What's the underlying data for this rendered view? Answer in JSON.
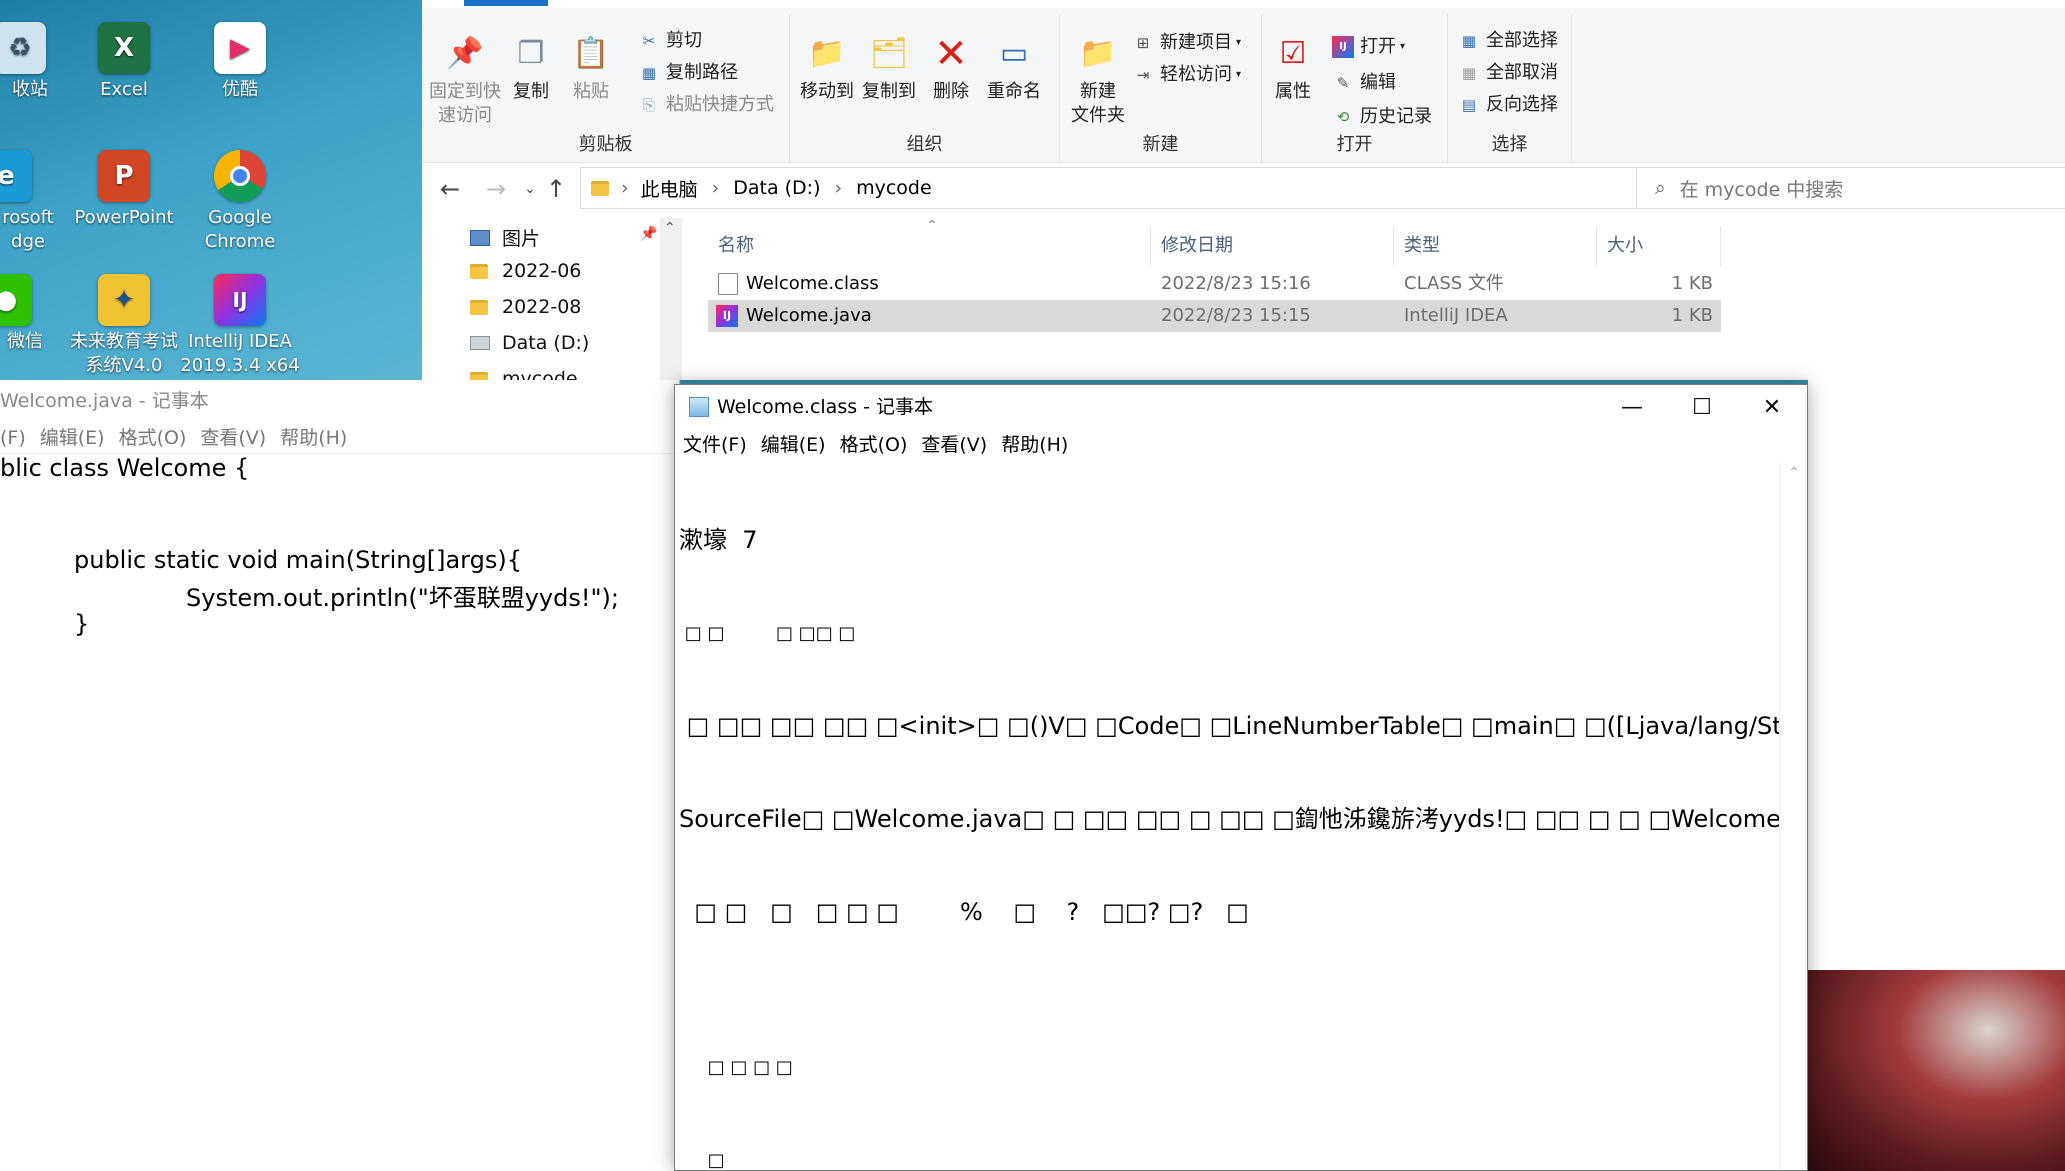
{
  "desktop": {
    "icons": [
      {
        "label": "收站"
      },
      {
        "label": "Excel"
      },
      {
        "label": "优酷"
      },
      {
        "label": "rosoft"
      },
      {
        "label": "dge"
      },
      {
        "label": "PowerPoint"
      },
      {
        "label": "Google"
      },
      {
        "label": "Chrome"
      },
      {
        "label": "微信"
      },
      {
        "label": "未来教育考试"
      },
      {
        "label": "系统V4.0"
      },
      {
        "label": "IntelliJ IDEA"
      },
      {
        "label": "2019.3.4 x64"
      }
    ]
  },
  "explorer": {
    "ribbon": {
      "clipboard": {
        "pin_line1": "固定到快",
        "pin_line2": "速访问",
        "copy": "复制",
        "paste": "粘贴",
        "cut": "剪切",
        "copy_path": "复制路径",
        "paste_shortcut": "粘贴快捷方式",
        "label": "剪贴板"
      },
      "organize": {
        "move_to": "移动到",
        "copy_to": "复制到",
        "delete": "删除",
        "rename": "重命名",
        "label": "组织"
      },
      "new": {
        "new_folder_line1": "新建",
        "new_folder_line2": "文件夹",
        "new_item": "新建项目",
        "easy_access": "轻松访问",
        "label": "新建"
      },
      "open": {
        "properties": "属性",
        "open": "打开",
        "edit": "编辑",
        "history": "历史记录",
        "label": "打开"
      },
      "select": {
        "select_all": "全部选择",
        "select_none": "全部取消",
        "invert": "反向选择",
        "label": "选择"
      }
    },
    "address": {
      "crumbs": [
        "此电脑",
        "Data (D:)",
        "mycode"
      ],
      "search_placeholder": "在 mycode 中搜索"
    },
    "nav": {
      "items": [
        "图片",
        "2022-06",
        "2022-08",
        "Data (D:)",
        "mycode"
      ]
    },
    "columns": {
      "name": "名称",
      "modified": "修改日期",
      "type": "类型",
      "size": "大小"
    },
    "files": [
      {
        "name": "Welcome.class",
        "modified": "2022/8/23 15:16",
        "type": "CLASS 文件",
        "size": "1 KB"
      },
      {
        "name": "Welcome.java",
        "modified": "2022/8/23 15:15",
        "type": "IntelliJ IDEA",
        "size": "1 KB"
      }
    ]
  },
  "notepad_left": {
    "title": "Welcome.java - 记事本",
    "menu": [
      "(F)",
      "编辑(E)",
      "格式(O)",
      "查看(V)",
      "帮助(H)"
    ],
    "code": [
      "blic class Welcome {",
      "public static void main(String[]args){",
      "System.out.println(\"坏蛋联盟yyds!\");",
      "}"
    ]
  },
  "notepad_right": {
    "title": "Welcome.class - 记事本",
    "menu": [
      "文件(F)",
      "编辑(E)",
      "格式(O)",
      "查看(V)",
      "帮助(H)"
    ],
    "lines": [
      "漱壕  7",
      " □ □         □ □□ □",
      " □ □□ □□ □□ □<init>□ □()V□ □Code□ □LineNumberTable□ □main□ □([Ljava/lang/String;)V□",
      "SourceFile□ □Welcome.java□ □ □□ □□ □ □□ □鍧忚泲鑱旂洘yyds!□ □□ □ □ □Welcome□ □java/lang",
      "  □ □   □   □ □ □        %    □    ?   □□? □?   □",
      "",
      "     □ □ □ □",
      "     □"
    ]
  }
}
